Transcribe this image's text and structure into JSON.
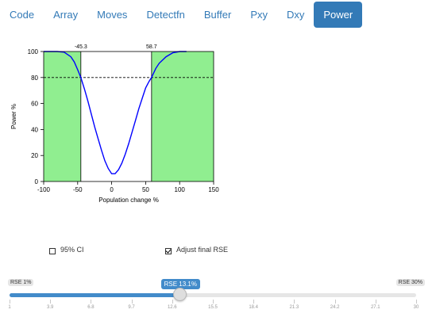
{
  "tabs": [
    {
      "label": "Code",
      "active": false
    },
    {
      "label": "Array",
      "active": false
    },
    {
      "label": "Moves",
      "active": false
    },
    {
      "label": "Detectfn",
      "active": false
    },
    {
      "label": "Buffer",
      "active": false
    },
    {
      "label": "Pxy",
      "active": false
    },
    {
      "label": "Dxy",
      "active": false
    },
    {
      "label": "Power",
      "active": true
    }
  ],
  "chart_data": {
    "type": "line",
    "xlabel": "Population change %",
    "ylabel": "Power %",
    "xlim": [
      -100,
      150
    ],
    "ylim": [
      0,
      100
    ],
    "xticks": [
      -100,
      -50,
      0,
      50,
      100,
      150
    ],
    "yticks": [
      0,
      20,
      40,
      60,
      80,
      100
    ],
    "reference_line_y": 80,
    "thresholds": [
      {
        "x": -45.3,
        "label": "-45.3"
      },
      {
        "x": 58.7,
        "label": "58.7"
      }
    ],
    "shade_color": "#90ee90",
    "line_color": "#0000ff",
    "series": [
      {
        "x": [
          -100,
          -80,
          -70,
          -60,
          -55,
          -50,
          -45.3,
          -40,
          -35,
          -30,
          -25,
          -20,
          -15,
          -10,
          -5,
          0,
          5,
          10,
          15,
          20,
          25,
          30,
          35,
          40,
          45,
          50,
          55,
          58.7,
          65,
          70,
          80,
          90,
          100,
          110
        ],
        "values": [
          100,
          100,
          99.5,
          96,
          92,
          86,
          80,
          71,
          62,
          52,
          42,
          33,
          24,
          16,
          10,
          6,
          6,
          9,
          14,
          21,
          29,
          38,
          47,
          56,
          64,
          72,
          77,
          80,
          87,
          91,
          96,
          99,
          100,
          100
        ]
      }
    ]
  },
  "controls": {
    "ci_label": "95% CI",
    "ci_checked": false,
    "adjust_label": "Adjust final RSE",
    "adjust_checked": true
  },
  "slider": {
    "min_label": "RSE 1%",
    "max_label": "RSE 30%",
    "current_label": "RSE 13.1%",
    "min": 1,
    "max": 30,
    "value": 13.1,
    "ticks": [
      "1",
      "3.9",
      "6.8",
      "9.7",
      "12.6",
      "15.5",
      "18.4",
      "21.3",
      "24.2",
      "27.1",
      "30"
    ]
  }
}
